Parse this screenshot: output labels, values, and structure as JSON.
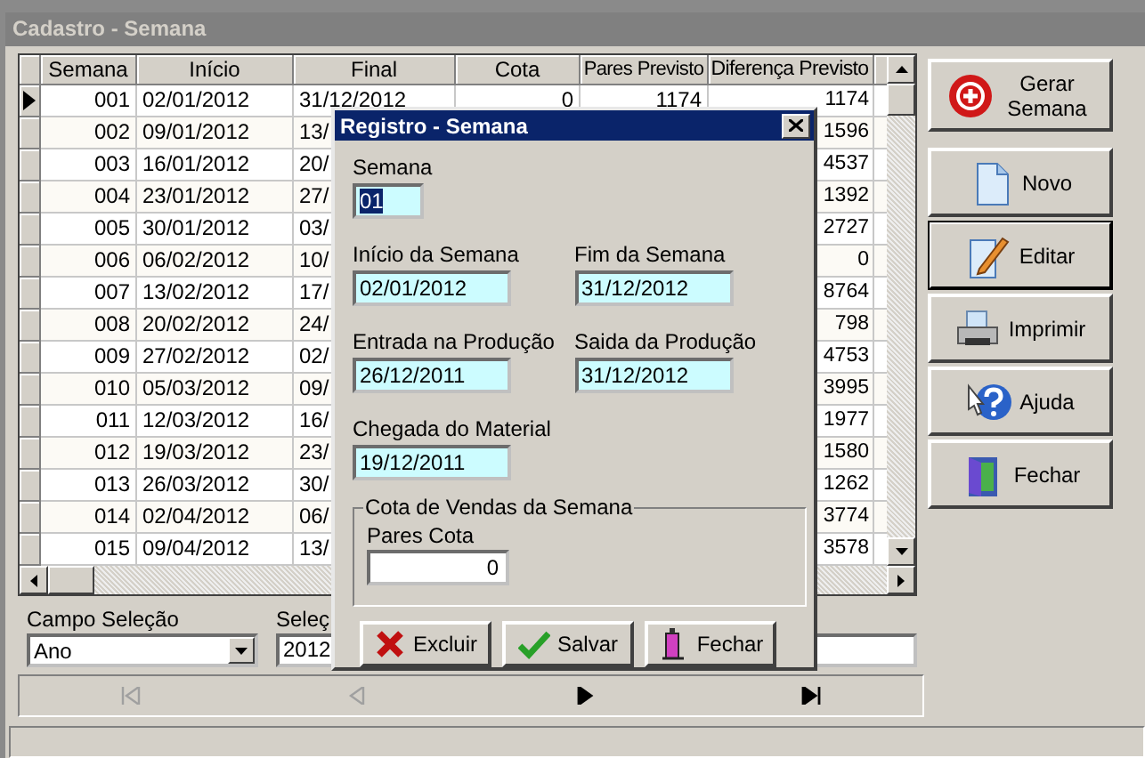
{
  "window": {
    "title": "Cadastro - Semana"
  },
  "grid": {
    "columns": [
      "Semana",
      "Início",
      "Final",
      "Cota",
      "Pares Previsto",
      "Diferença Previsto"
    ],
    "rows": [
      {
        "semana": "001",
        "inicio": "02/01/2012",
        "final": "31/12/2012",
        "cota": "0",
        "pares": "1174",
        "diferenca": "1174",
        "selected": true
      },
      {
        "semana": "002",
        "inicio": "09/01/2012",
        "final": "13/",
        "diferenca": "1596",
        "selected": false
      },
      {
        "semana": "003",
        "inicio": "16/01/2012",
        "final": "20/",
        "diferenca": "4537",
        "selected": false
      },
      {
        "semana": "004",
        "inicio": "23/01/2012",
        "final": "27/",
        "diferenca": "1392",
        "selected": false
      },
      {
        "semana": "005",
        "inicio": "30/01/2012",
        "final": "03/",
        "diferenca": "2727",
        "selected": false
      },
      {
        "semana": "006",
        "inicio": "06/02/2012",
        "final": "10/",
        "diferenca": "0",
        "selected": false
      },
      {
        "semana": "007",
        "inicio": "13/02/2012",
        "final": "17/",
        "diferenca": "8764",
        "selected": false
      },
      {
        "semana": "008",
        "inicio": "20/02/2012",
        "final": "24/",
        "diferenca": "798",
        "selected": false
      },
      {
        "semana": "009",
        "inicio": "27/02/2012",
        "final": "02/",
        "diferenca": "4753",
        "selected": false
      },
      {
        "semana": "010",
        "inicio": "05/03/2012",
        "final": "09/",
        "diferenca": "3995",
        "selected": false
      },
      {
        "semana": "011",
        "inicio": "12/03/2012",
        "final": "16/",
        "diferenca": "1977",
        "selected": false
      },
      {
        "semana": "012",
        "inicio": "19/03/2012",
        "final": "23/",
        "diferenca": "1580",
        "selected": false
      },
      {
        "semana": "013",
        "inicio": "26/03/2012",
        "final": "30/",
        "diferenca": "1262",
        "selected": false
      },
      {
        "semana": "014",
        "inicio": "02/04/2012",
        "final": "06/",
        "diferenca": "3774",
        "selected": false
      },
      {
        "semana": "015",
        "inicio": "09/04/2012",
        "final": "13/",
        "diferenca": "3578",
        "selected": false
      }
    ]
  },
  "filter": {
    "field_label": "Campo Seleção",
    "field_value": "Ano",
    "selection_label": "Seleç",
    "selection_value": "2012"
  },
  "navigator": [
    {
      "kind": "first",
      "disabled": true
    },
    {
      "kind": "prior",
      "disabled": true
    },
    {
      "kind": "next",
      "disabled": false
    },
    {
      "kind": "last",
      "disabled": false
    }
  ],
  "actions": [
    {
      "kind": "generate",
      "label": "Gerar Semana",
      "focused": false
    },
    {
      "kind": "new",
      "label": "Novo",
      "focused": false
    },
    {
      "kind": "edit",
      "label": "Editar",
      "focused": true
    },
    {
      "kind": "print",
      "label": "Imprimir",
      "focused": false
    },
    {
      "kind": "help",
      "label": "Ajuda",
      "focused": false
    },
    {
      "kind": "close",
      "label": "Fechar",
      "focused": false
    }
  ],
  "dialog": {
    "title": "Registro - Semana",
    "field_rows": [
      [
        {
          "label": "Semana",
          "value": "01",
          "kind": "short",
          "selected": true
        }
      ],
      [
        {
          "label": "Início da Semana",
          "value": "02/01/2012",
          "kind": "date",
          "selected": false
        },
        {
          "label": "Fim da Semana",
          "value": "31/12/2012",
          "kind": "date",
          "selected": false
        }
      ],
      [
        {
          "label": "Entrada na Produção",
          "value": "26/12/2011",
          "kind": "date",
          "selected": false
        },
        {
          "label": "Saida da Produção",
          "value": "31/12/2012",
          "kind": "date",
          "selected": false
        }
      ],
      [
        {
          "label": "Chegada do Material",
          "value": "19/12/2011",
          "kind": "date",
          "selected": false
        }
      ]
    ],
    "group": {
      "title": "Cota de Vendas da Semana",
      "label": "Pares Cota",
      "value": "0"
    },
    "buttons": [
      {
        "kind": "delete",
        "label": "Excluir"
      },
      {
        "kind": "save",
        "label": "Salvar"
      },
      {
        "kind": "close",
        "label": "Fechar"
      }
    ]
  }
}
